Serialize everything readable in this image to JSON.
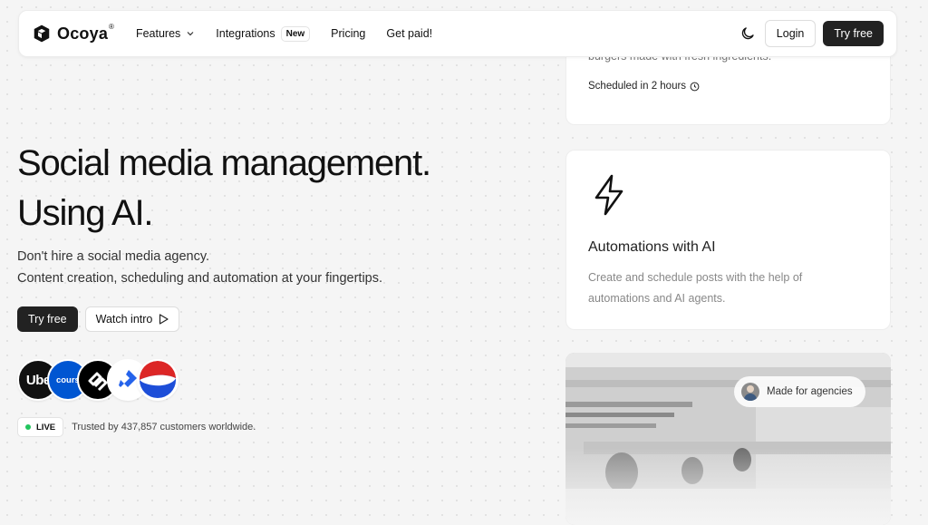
{
  "nav": {
    "brand": "Ocoya",
    "brand_mark": "®",
    "links": [
      {
        "label": "Features",
        "has_chevron": true
      },
      {
        "label": "Integrations",
        "badge": "New"
      },
      {
        "label": "Pricing"
      },
      {
        "label": "Get paid!"
      }
    ],
    "login_label": "Login",
    "try_label": "Try free",
    "theme_icon": "moon-icon"
  },
  "hero": {
    "title_line1": "Social media management.",
    "title_line2": "Using AI.",
    "subtitle_line1": "Don't hire a social media agency.",
    "subtitle_line2": "Content creation, scheduling and automation at your fingertips.",
    "try_label": "Try free",
    "watch_label": "Watch intro"
  },
  "brands": [
    {
      "name": "Uber",
      "text": "Uber",
      "bg": "#111111",
      "fg": "#ffffff"
    },
    {
      "name": "Coursera",
      "text": "coursera",
      "bg": "#0056d2",
      "fg": "#ffffff"
    },
    {
      "name": "Squarespace",
      "text": "",
      "bg": "#000000",
      "fg": "#ffffff"
    },
    {
      "name": "Toptal",
      "text": "",
      "bg": "#ffffff",
      "fg": "#2563eb"
    },
    {
      "name": "Pepsi",
      "text": "",
      "bg": "#ffffff",
      "fg": "#1d4ed8"
    }
  ],
  "social_proof": {
    "live_label": "LIVE",
    "trusted_text": "Trusted by 437,857 customers worldwide."
  },
  "cards": {
    "scheduled": {
      "desc_partial": "burgers made with fresh ingredients.",
      "status": "Scheduled in 2 hours"
    },
    "automations": {
      "icon": "lightning-icon",
      "title": "Automations with AI",
      "text": "Create and schedule posts with the help of automations and AI agents."
    },
    "agencies": {
      "badge": "Made for agencies"
    }
  },
  "colors": {
    "accent_dark": "#222222",
    "live_dot": "#22c55e",
    "background": "#f5f5f5"
  }
}
